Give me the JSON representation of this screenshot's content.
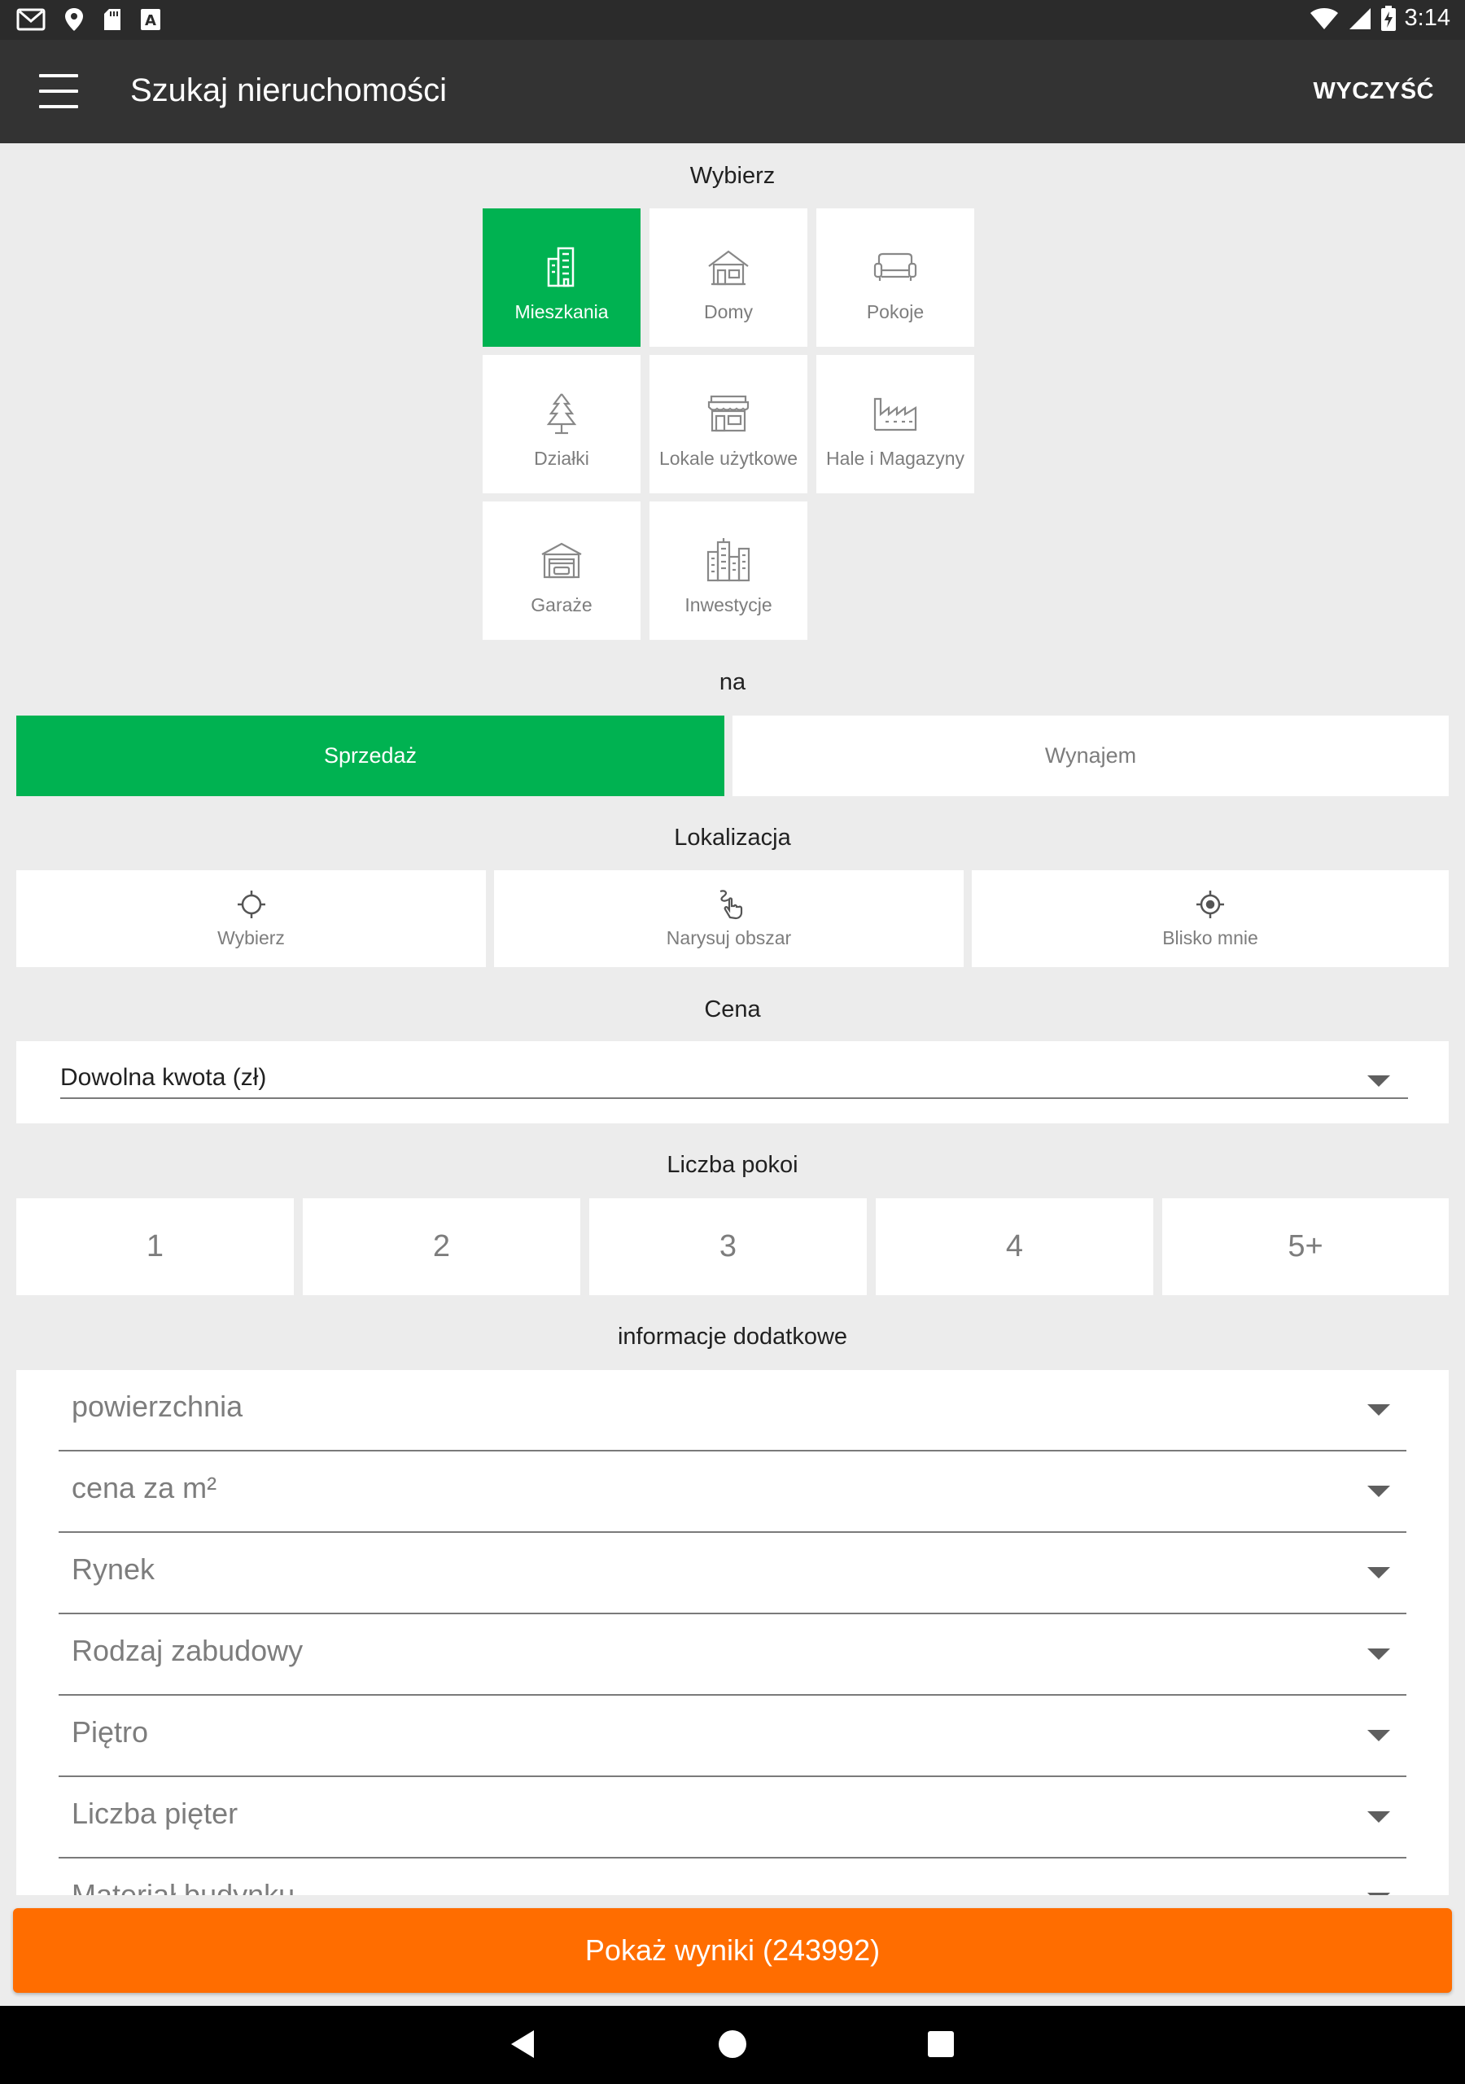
{
  "status_bar": {
    "time": "3:14",
    "icons": [
      "gmail-icon",
      "location-pin-icon",
      "sd-card-icon",
      "a-letter-icon",
      "wifi-icon",
      "signal-icon",
      "battery-charging-icon"
    ]
  },
  "app_bar": {
    "title": "Szukaj nieruchomości",
    "clear_label": "WYCZYŚĆ",
    "menu_icon": "hamburger-menu-icon"
  },
  "property_type": {
    "heading": "Wybierz",
    "options": [
      {
        "label": "Mieszkania",
        "icon": "apartment-building-icon",
        "selected": true
      },
      {
        "label": "Domy",
        "icon": "house-icon",
        "selected": false
      },
      {
        "label": "Pokoje",
        "icon": "sofa-icon",
        "selected": false
      },
      {
        "label": "Działki",
        "icon": "tree-icon",
        "selected": false
      },
      {
        "label": "Lokale użytkowe",
        "icon": "storefront-icon",
        "selected": false
      },
      {
        "label": "Hale i Magazyny",
        "icon": "factory-icon",
        "selected": false
      },
      {
        "label": "Garaże",
        "icon": "garage-icon",
        "selected": false
      },
      {
        "label": "Inwestycje",
        "icon": "city-buildings-icon",
        "selected": false
      }
    ]
  },
  "transaction": {
    "heading": "na",
    "options": [
      {
        "label": "Sprzedaż",
        "selected": true
      },
      {
        "label": "Wynajem",
        "selected": false
      }
    ]
  },
  "location": {
    "heading": "Lokalizacja",
    "options": [
      {
        "label": "Wybierz",
        "icon": "crosshair-icon"
      },
      {
        "label": "Narysuj obszar",
        "icon": "draw-hand-icon"
      },
      {
        "label": "Blisko mnie",
        "icon": "my-location-icon"
      }
    ]
  },
  "price": {
    "heading": "Cena",
    "value": "Dowolna kwota (zł)"
  },
  "rooms": {
    "heading": "Liczba pokoi",
    "options": [
      "1",
      "2",
      "3",
      "4",
      "5+"
    ]
  },
  "additional": {
    "heading": "informacje dodatkowe",
    "fields": [
      "powierzchnia",
      "cena za m²",
      "Rynek",
      "Rodzaj zabudowy",
      "Piętro",
      "Liczba pięter",
      "Materiał budynku"
    ]
  },
  "results": {
    "label": "Pokaż wyniki (243992)"
  },
  "colors": {
    "accent_green": "#00b251",
    "accent_orange": "#ff6d00",
    "app_bar": "#333333",
    "background": "#ececec"
  }
}
